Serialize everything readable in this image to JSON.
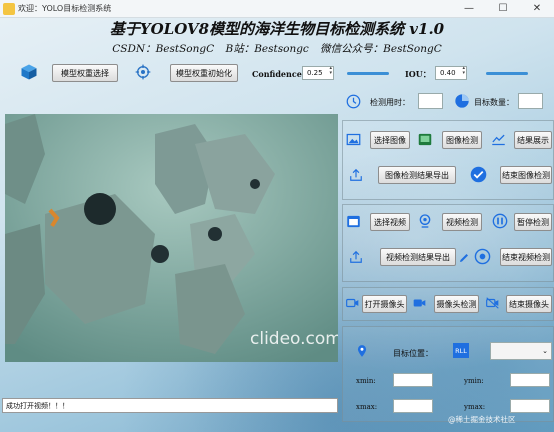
{
  "window": {
    "title": "欢迎：YOLO目标检测系统",
    "minimize": "—",
    "maximize": "☐",
    "close": "✕"
  },
  "header": {
    "title": "基于YOLOV8模型的海洋生物目标检测系统 v1.0",
    "csdn": "CSDN：BestSongC",
    "bilibili": "B站：Bestsongc",
    "wechat": "微信公众号：BestSongC"
  },
  "toolbar": {
    "select_weights": "模型权重选择",
    "init_weights": "模型权重初始化",
    "confidence_label": "Confidence",
    "confidence_value": "0.25",
    "confidence_level": 0.25,
    "iou_label": "IOU：",
    "iou_value": "0.40",
    "iou_level": 0.4
  },
  "stats": {
    "time_label": "检测用时：",
    "time_value": "",
    "count_label": "目标数量：",
    "count_value": ""
  },
  "image_section": {
    "select_image": "选择图像",
    "detect_image": "图像检测",
    "show_result": "结果展示",
    "export_image_result": "图像检测结果导出",
    "end_image_detect": "结束图像检测"
  },
  "video_section": {
    "select_video": "选择视频",
    "detect_video": "视频检测",
    "pause_detect": "暂停检测",
    "export_video_result": "视频检测结果导出",
    "end_video_detect": "结束视频检测"
  },
  "camera_section": {
    "open_camera": "打开摄像头",
    "camera_detect": "摄像头检测",
    "close_camera": "结束摄像头"
  },
  "target_section": {
    "position_label": "目标位置：",
    "rll_label": "RLL",
    "xmin": "xmin:",
    "ymin": "ymin:",
    "xmax": "xmax:",
    "ymax": "ymax:",
    "combo_value": ""
  },
  "video": {
    "watermark": "clideo.com"
  },
  "status_bar": {
    "message": "成功打开视频！！！"
  },
  "footer": {
    "credit": "@稀土掘金技术社区"
  },
  "colors": {
    "accent": "#1f6fe0",
    "slider": "#3b8fd6"
  }
}
